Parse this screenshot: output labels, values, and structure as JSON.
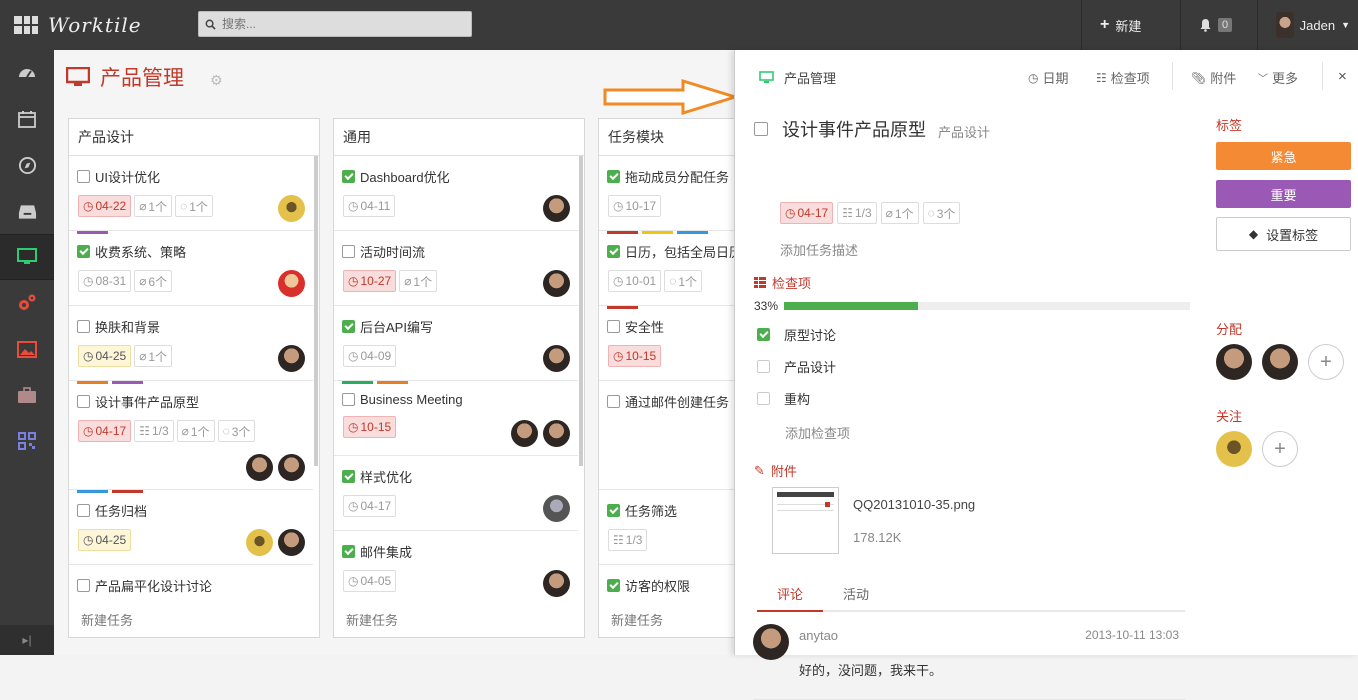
{
  "app": {
    "name": "Worktile"
  },
  "topbar": {
    "search_placeholder": "搜索...",
    "new_label": "新建",
    "notif_count": "0",
    "user_name": "Jaden"
  },
  "project": {
    "title": "产品管理"
  },
  "columns": [
    {
      "title": "产品设计",
      "new_task": "新建任务",
      "tasks": [
        {
          "title": "UI设计优化",
          "done": false,
          "bars": [],
          "metas": [
            {
              "kind": "date",
              "text": "04-22",
              "style": "red"
            },
            {
              "kind": "attach",
              "text": "1个"
            },
            {
              "kind": "comment",
              "text": "1个"
            }
          ],
          "avatars": [
            "av2"
          ]
        },
        {
          "title": "收费系统、策略",
          "done": true,
          "bars": [
            "#9b59b6"
          ],
          "metas": [
            {
              "kind": "date",
              "text": "08-31"
            },
            {
              "kind": "attach",
              "text": "6个"
            }
          ],
          "avatars": [
            "av3"
          ]
        },
        {
          "title": "换肤和背景",
          "done": false,
          "bars": [],
          "metas": [
            {
              "kind": "date",
              "text": "04-25",
              "style": "yellow"
            },
            {
              "kind": "attach",
              "text": "1个"
            }
          ],
          "avatars": [
            "av1"
          ]
        },
        {
          "title": "设计事件产品原型",
          "done": false,
          "bars": [
            "#e67e22",
            "#9b59b6"
          ],
          "metas": [
            {
              "kind": "date",
              "text": "04-17",
              "style": "red"
            },
            {
              "kind": "check",
              "text": "1/3"
            },
            {
              "kind": "attach",
              "text": "1个"
            },
            {
              "kind": "comment",
              "text": "3个"
            }
          ],
          "avatars": [
            "av1",
            "av1"
          ],
          "tall": true
        },
        {
          "title": "任务归档",
          "done": false,
          "bars": [
            "#3498db",
            "#c0392b"
          ],
          "metas": [
            {
              "kind": "date",
              "text": "04-25",
              "style": "yellow"
            }
          ],
          "avatars": [
            "av2",
            "av1"
          ]
        },
        {
          "title": "产品扁平化设计讨论",
          "done": false,
          "bars": [],
          "metas": [],
          "avatars": []
        }
      ]
    },
    {
      "title": "通用",
      "new_task": "新建任务",
      "tasks": [
        {
          "title": "Dashboard优化",
          "done": true,
          "bars": [],
          "metas": [
            {
              "kind": "date",
              "text": "04-11"
            }
          ],
          "avatars": [
            "av1"
          ]
        },
        {
          "title": "活动时间流",
          "done": false,
          "bars": [],
          "metas": [
            {
              "kind": "date",
              "text": "10-27",
              "style": "red"
            },
            {
              "kind": "attach",
              "text": "1个"
            }
          ],
          "avatars": [
            "av1"
          ]
        },
        {
          "title": "后台API编写",
          "done": true,
          "bars": [],
          "metas": [
            {
              "kind": "date",
              "text": "04-09"
            }
          ],
          "avatars": [
            "av1"
          ]
        },
        {
          "title": "Business Meeting",
          "done": false,
          "bars": [
            "#27ae60",
            "#e67e22"
          ],
          "metas": [
            {
              "kind": "date",
              "text": "10-15",
              "style": "red"
            }
          ],
          "avatars": [
            "av1",
            "av1"
          ]
        },
        {
          "title": "样式优化",
          "done": true,
          "bars": [],
          "metas": [
            {
              "kind": "date",
              "text": "04-17"
            }
          ],
          "avatars": [
            "av4"
          ]
        },
        {
          "title": "邮件集成",
          "done": true,
          "bars": [],
          "metas": [
            {
              "kind": "date",
              "text": "04-05"
            }
          ],
          "avatars": [
            "av1"
          ]
        }
      ]
    },
    {
      "title": "任务模块",
      "new_task": "新建任务",
      "tasks": [
        {
          "title": "拖动成员分配任务",
          "done": true,
          "bars": [],
          "metas": [
            {
              "kind": "date",
              "text": "10-17"
            }
          ],
          "avatars": []
        },
        {
          "title": "日历，包括全局日历，任务在日历的创",
          "title2": "历，任务在日历的创",
          "done": true,
          "bars": [
            "#c0392b",
            "#f1c40f",
            "#3498db"
          ],
          "metas": [
            {
              "kind": "date",
              "text": "10-01"
            },
            {
              "kind": "comment",
              "text": "1个"
            }
          ],
          "avatars": []
        },
        {
          "title": "安全性",
          "done": false,
          "bars": [
            "#c0392b"
          ],
          "metas": [
            {
              "kind": "date",
              "text": "10-15",
              "style": "red"
            }
          ],
          "avatars": []
        },
        {
          "title": "通过邮件创建任务",
          "done": false,
          "bars": [],
          "metas": [],
          "avatars": [],
          "tall": true
        },
        {
          "title": "任务筛选",
          "done": true,
          "bars": [],
          "metas": [
            {
              "kind": "check",
              "text": "1/3"
            }
          ],
          "avatars": []
        },
        {
          "title": "访客的权限",
          "done": true,
          "bars": [],
          "metas": [],
          "avatars": []
        }
      ]
    }
  ],
  "panel": {
    "crumb": "产品管理",
    "actions": {
      "date": "日期",
      "checklist": "检查项",
      "attach": "附件",
      "more": "更多"
    },
    "task_title": "设计事件产品原型",
    "task_list": "产品设计",
    "metas": {
      "date": "04-17",
      "check": "1/3",
      "attach": "1个",
      "comment": "3个"
    },
    "add_desc": "添加任务描述",
    "checklist": {
      "title": "检查项",
      "percent_label": "33%",
      "percent": 0.33,
      "items": [
        {
          "label": "原型讨论",
          "done": true
        },
        {
          "label": "产品设计",
          "done": false
        },
        {
          "label": "重构",
          "done": false
        }
      ],
      "add": "添加检查项"
    },
    "attachments": {
      "title": "附件",
      "file_name": "QQ20131010-35.png",
      "file_size": "178.12K"
    },
    "tabs": {
      "comment": "评论",
      "activity": "活动"
    },
    "comment": {
      "author": "anytao",
      "time": "2013-10-11 13:03",
      "text": "好的，没问题，我来干。"
    },
    "right": {
      "tags_title": "标签",
      "tag1": "紧急",
      "tag1_color": "#f58a35",
      "tag2": "重要",
      "tag2_color": "#9b59b6",
      "set_tags": "设置标签",
      "assign_title": "分配",
      "follow_title": "关注"
    }
  }
}
